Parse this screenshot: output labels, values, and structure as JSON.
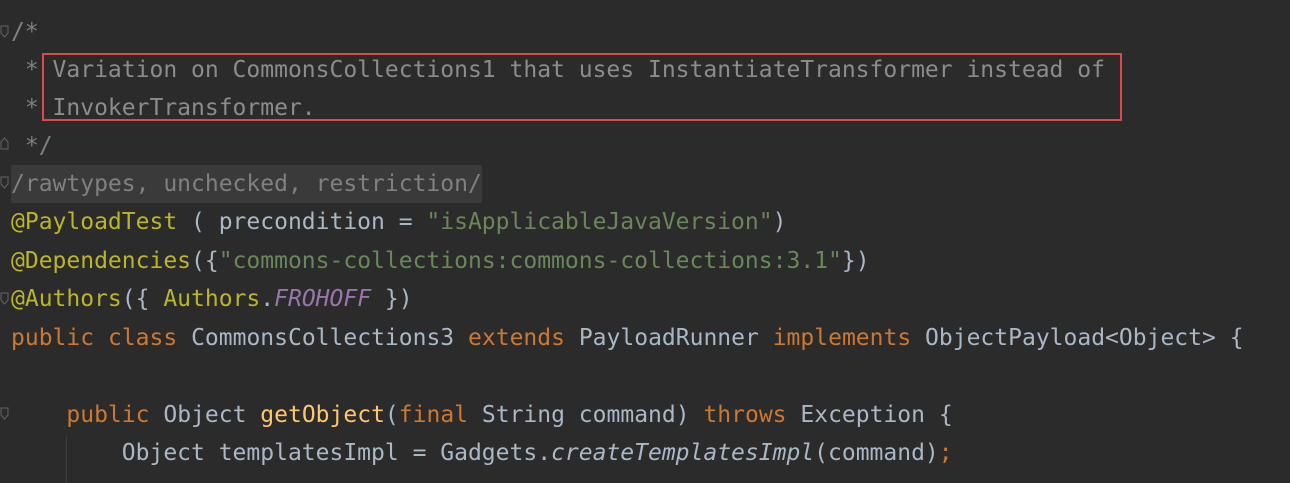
{
  "code": {
    "line1": "/*",
    "line2_prefix": " * ",
    "line2_text": "Variation on CommonsCollections1 that uses InstantiateTransformer instead of",
    "line3_prefix": " * ",
    "line3_text": "InvokerTransformer.",
    "line4": " */",
    "line5": "/rawtypes, unchecked, restriction/",
    "line6": {
      "annotation": "@PayloadTest",
      "open": " ( precondition = ",
      "string": "\"isApplicableJavaVersion\"",
      "close": ")"
    },
    "line7": {
      "annotation": "@Dependencies",
      "open": "({",
      "string": "\"commons-collections:commons-collections:3.1\"",
      "close": "})"
    },
    "line8": {
      "annotation": "@Authors",
      "open": "({ ",
      "type": "Authors",
      "dot": ".",
      "constant": "FROHOFF",
      "close": " })"
    },
    "line9": {
      "kw1": "public",
      "kw2": "class",
      "class_name": "CommonsCollections3",
      "kw3": "extends",
      "parent": "PayloadRunner",
      "kw4": "implements",
      "iface": "ObjectPayload<Object>",
      "brace": " {"
    },
    "line11": {
      "kw1": "public",
      "ret": "Object",
      "method": "getObject",
      "open": "(",
      "kw2": "final",
      "params": " String command) ",
      "kw3": "throws",
      "exc": " Exception {"
    },
    "line12": {
      "decl": "Object templatesImpl = Gadgets.",
      "call": "createTemplatesImpl",
      "args": "(command)",
      "semi": ";"
    }
  },
  "colors": {
    "background": "#2b2b2b",
    "highlight_border": "#e0484e"
  }
}
